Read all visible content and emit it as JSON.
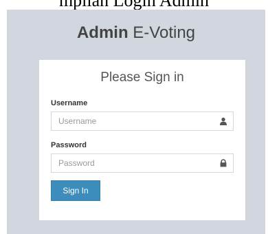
{
  "caption": "mpilan Login Admin",
  "header": {
    "logo_bold": "Admin",
    "logo_rest": " E-Voting"
  },
  "login": {
    "message": "Please Sign in",
    "username": {
      "label": "Username",
      "placeholder": "Username",
      "value": "",
      "icon": "user-icon"
    },
    "password": {
      "label": "Password",
      "placeholder": "Password",
      "value": "",
      "icon": "lock-icon"
    },
    "submit_label": "Sign In"
  },
  "colors": {
    "backdrop": "#d2d6de",
    "primary": "#3c8dbc",
    "text": "#444444"
  }
}
